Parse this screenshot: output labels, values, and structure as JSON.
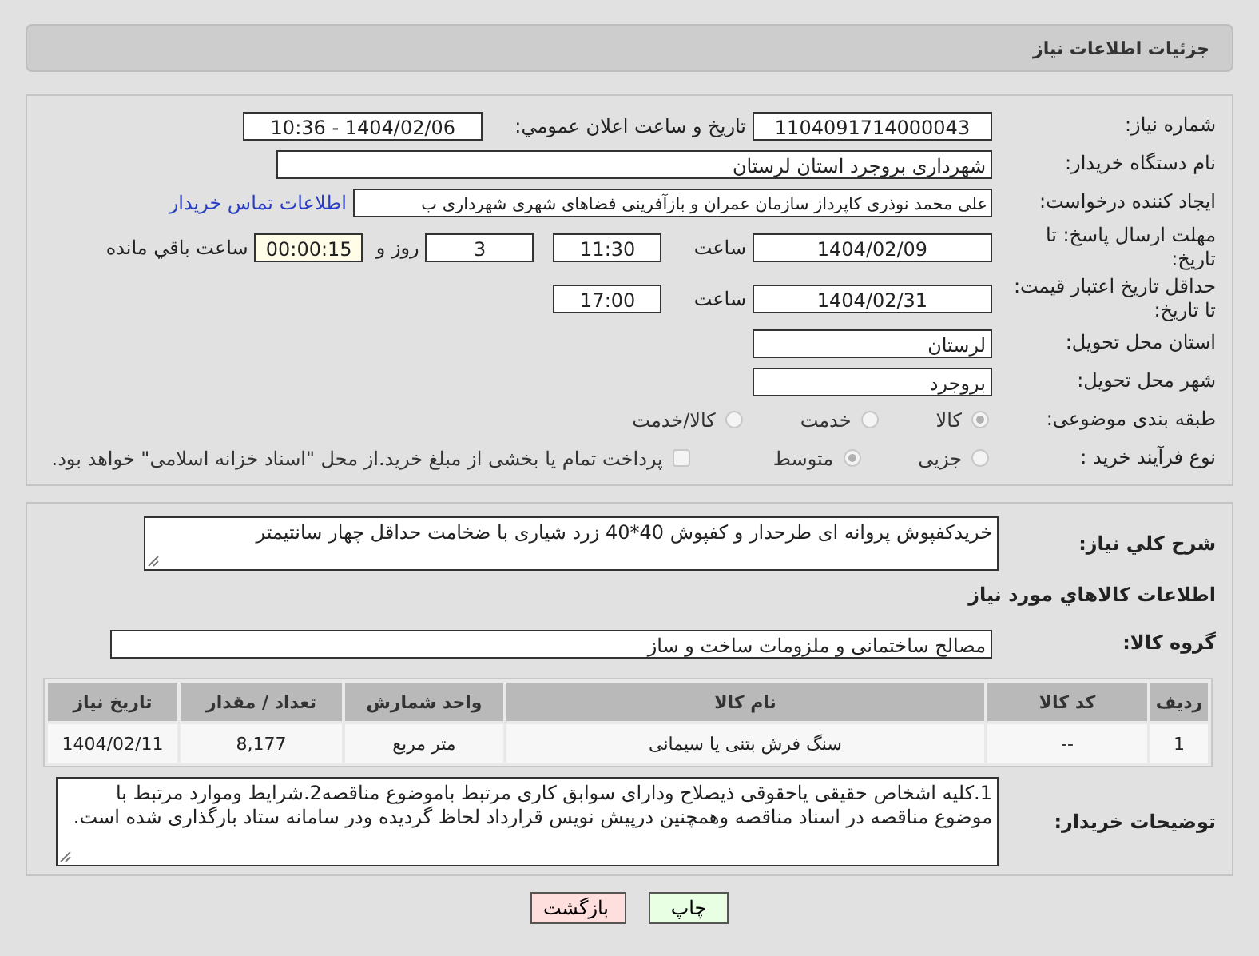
{
  "header": {
    "title": "جزئیات اطلاعات نیاز"
  },
  "need_number": {
    "label": "شماره نیاز:",
    "value": "1104091714000043"
  },
  "announce": {
    "label": "تاریخ و ساعت اعلان عمومي:",
    "value": "1404/02/06 - 10:36"
  },
  "buyer_org": {
    "label": "نام دستگاه خریدار:",
    "value": "شهرداری بروجرد استان لرستان"
  },
  "requester": {
    "label": "ایجاد کننده درخواست:",
    "value": "علی محمد نوذری کاپرداز سازمان عمران و بازآفرینی فضاهای شهری شهرداری ب",
    "contact_link": "اطلاعات تماس خریدار"
  },
  "reply_deadline": {
    "label": "مهلت ارسال پاسخ: تا تاریخ:",
    "date": "1404/02/09",
    "time_label": "ساعت",
    "time": "11:30",
    "days": "3",
    "days_label": "روز و",
    "remaining": "00:00:15",
    "remaining_label": "ساعت باقي مانده"
  },
  "price_validity": {
    "label": "حداقل تاریخ اعتبار قیمت: تا تاریخ:",
    "date": "1404/02/31",
    "time_label": "ساعت",
    "time": "17:00"
  },
  "delivery_province": {
    "label": "استان محل تحویل:",
    "value": "لرستان"
  },
  "delivery_city": {
    "label": "شهر محل تحویل:",
    "value": "بروجرد"
  },
  "subject_class": {
    "label": "طبقه بندی موضوعی:",
    "options": [
      {
        "label": "کالا",
        "selected": true
      },
      {
        "label": "خدمت",
        "selected": false
      },
      {
        "label": "کالا/خدمت",
        "selected": false
      }
    ]
  },
  "purchase_type": {
    "label": "نوع فرآیند خرید :",
    "options": [
      {
        "label": "جزیی",
        "selected": false
      },
      {
        "label": "متوسط",
        "selected": true
      }
    ],
    "treasury": {
      "label": "پرداخت تمام یا بخشی از مبلغ خرید.از محل \"اسناد خزانه اسلامی\" خواهد بود.",
      "checked": false
    }
  },
  "description": {
    "label": "شرح کلي نیاز:",
    "value": "خریدکفپوش پروانه ای طرحدار و کفپوش 40*40 زرد شیاری با ضخامت حداقل چهار سانتیمتر"
  },
  "goods_heading": "اطلاعات کالاهاي مورد نیاز",
  "goods_group": {
    "label": "گروه کالا:",
    "value": "مصالح ساختمانی و ملزومات ساخت و ساز"
  },
  "table": {
    "columns": [
      "ردیف",
      "کد کالا",
      "نام کالا",
      "واحد شمارش",
      "تعداد / مقدار",
      "تاریخ نیاز"
    ],
    "rows": [
      [
        "1",
        "--",
        "سنگ فرش بتنی یا سیمانی",
        "متر مربع",
        "8,177",
        "1404/02/11"
      ]
    ]
  },
  "buyer_notes": {
    "label": "توضیحات خریدار:",
    "value": "1.کلیه اشخاص حقیقی یاحقوقی ذیصلاح ودارای سوابق کاری مرتبط باموضوع مناقصه2.شرایط وموارد مرتبط با موضوع مناقصه در اسناد مناقصه وهمچنین درپیش نویس قرارداد لحاظ گردیده ودر سامانه ستاد بارگذاری شده است."
  },
  "buttons": [
    {
      "label": "چاپ",
      "kind": "print"
    },
    {
      "label": "بازگشت",
      "kind": "back"
    }
  ]
}
